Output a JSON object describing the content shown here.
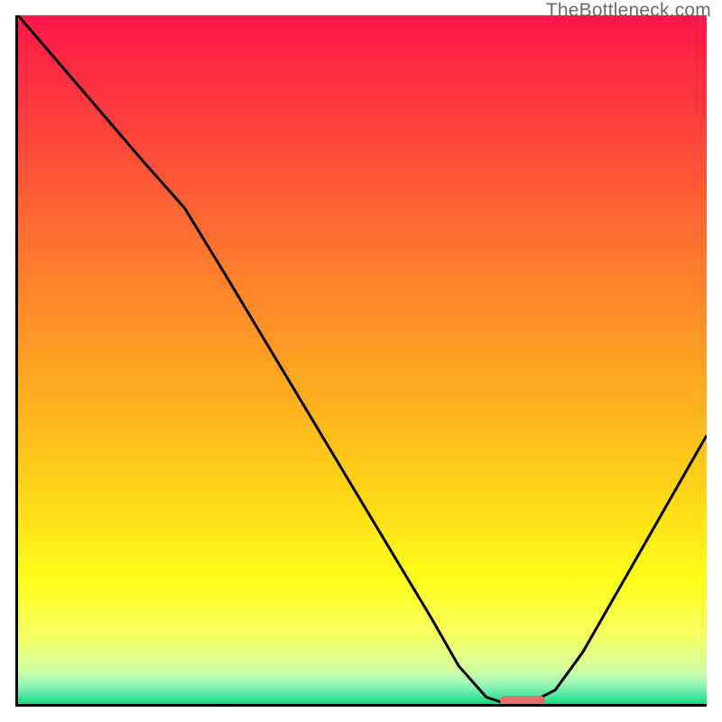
{
  "watermark": "TheBottleneck.com",
  "chart_data": {
    "type": "line",
    "title": "",
    "xlabel": "",
    "ylabel": "",
    "xlim": [
      0,
      100
    ],
    "ylim": [
      0,
      100
    ],
    "grid": false,
    "legend": false,
    "background_gradient_stops": [
      {
        "pos": 0.0,
        "color": "#ff1748"
      },
      {
        "pos": 0.14,
        "color": "#ff3b3f"
      },
      {
        "pos": 0.28,
        "color": "#ff6433"
      },
      {
        "pos": 0.42,
        "color": "#ff8a29"
      },
      {
        "pos": 0.56,
        "color": "#ffb01f"
      },
      {
        "pos": 0.7,
        "color": "#ffd718"
      },
      {
        "pos": 0.82,
        "color": "#ffff1a"
      },
      {
        "pos": 0.9,
        "color": "#f4ff60"
      },
      {
        "pos": 0.95,
        "color": "#d4ffa0"
      },
      {
        "pos": 0.97,
        "color": "#9ef7b8"
      },
      {
        "pos": 0.985,
        "color": "#5ae9a5"
      },
      {
        "pos": 1.0,
        "color": "#17db7e"
      }
    ],
    "series": [
      {
        "name": "bottleneck-curve",
        "x": [
          0.0,
          6.0,
          12.0,
          18.0,
          24.2,
          30.0,
          36.0,
          42.0,
          48.0,
          54.0,
          60.0,
          64.0,
          68.0,
          71.0,
          74.0,
          78.0,
          82.0,
          86.0,
          90.0,
          94.0,
          98.0,
          100.0
        ],
        "y": [
          100.0,
          93.0,
          86.0,
          79.0,
          72.0,
          62.5,
          52.5,
          42.5,
          32.5,
          22.5,
          12.5,
          5.5,
          1.0,
          0.0,
          0.0,
          2.0,
          7.5,
          14.5,
          21.5,
          28.5,
          35.5,
          39.0
        ]
      }
    ],
    "marker": {
      "name": "optimal-marker",
      "x_start": 70.0,
      "x_end": 76.5,
      "y": 0.5,
      "color": "#e26f6f"
    }
  }
}
